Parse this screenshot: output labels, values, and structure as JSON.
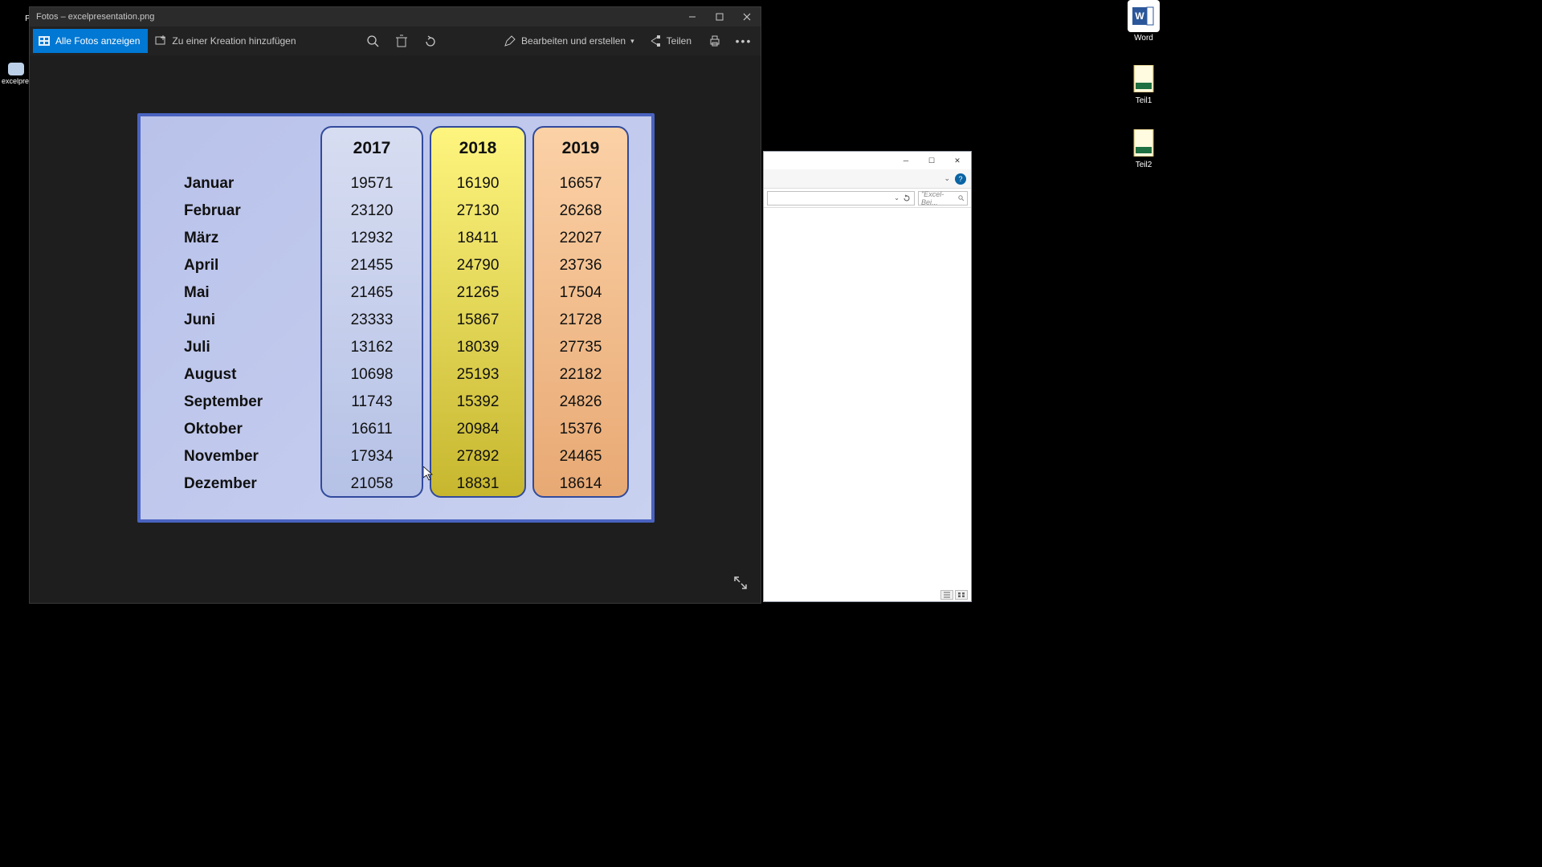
{
  "photos": {
    "title": "Fotos – excelpresentation.png",
    "see_all": "Alle Fotos anzeigen",
    "add_creation": "Zu einer Kreation hinzufügen",
    "edit_create": "Bearbeiten und erstellen",
    "share": "Teilen"
  },
  "desktop": {
    "word": "Word",
    "teil1": "Teil1",
    "teil2": "Teil2",
    "pap": "Pap",
    "excelpres": "excelpres"
  },
  "explorer": {
    "search_placeholder": "\"Excel-Bei..."
  },
  "chart_data": {
    "type": "table",
    "title": "",
    "columns": [
      "2017",
      "2018",
      "2019"
    ],
    "categories": [
      "Januar",
      "Februar",
      "März",
      "April",
      "Mai",
      "Juni",
      "Juli",
      "August",
      "September",
      "Oktober",
      "November",
      "Dezember"
    ],
    "series": [
      {
        "name": "2017",
        "values": [
          19571,
          23120,
          12932,
          21455,
          21465,
          23333,
          13162,
          10698,
          11743,
          16611,
          17934,
          21058
        ]
      },
      {
        "name": "2018",
        "values": [
          16190,
          27130,
          18411,
          24790,
          21265,
          15867,
          18039,
          25193,
          15392,
          20984,
          27892,
          18831
        ]
      },
      {
        "name": "2019",
        "values": [
          16657,
          26268,
          22027,
          23736,
          17504,
          21728,
          27735,
          22182,
          24826,
          15376,
          24465,
          18614
        ]
      }
    ]
  }
}
